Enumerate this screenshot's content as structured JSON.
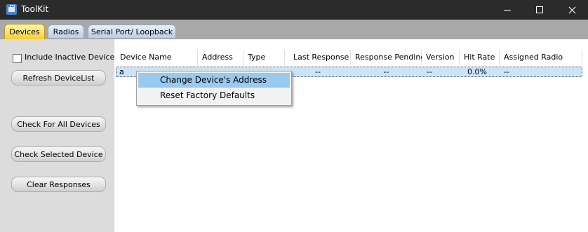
{
  "window": {
    "title": "ToolKit"
  },
  "tabs": [
    {
      "label": "Devices",
      "active": true
    },
    {
      "label": "Radios",
      "active": false
    },
    {
      "label": "Serial Port/ Loopback",
      "active": false
    }
  ],
  "left_panel": {
    "include_inactive": {
      "label": "Include Inactive Devices",
      "checked": false
    },
    "buttons": {
      "refresh": "Refresh DeviceList",
      "check_all": "Check For All Devices",
      "check_selected": "Check Selected Device",
      "clear": "Clear Responses"
    }
  },
  "table": {
    "columns": [
      "Device Name",
      "Address",
      "Type",
      "Last Response",
      "Response Pending",
      "Version",
      "Hit Rate",
      "Assigned Radio"
    ],
    "rows": [
      [
        "a",
        "",
        "",
        "--",
        "--",
        "--",
        "0.0%",
        "--"
      ]
    ]
  },
  "context_menu": {
    "items": [
      "Change Device's Address",
      "Reset Factory Defaults"
    ],
    "highlighted_index": 0
  },
  "colors": {
    "titlebar": "#2b2b2b",
    "tab_active": "#f5cd3a",
    "tab_inactive": "#b9cfe8",
    "selection": "#cce4f7",
    "menu_highlight": "#99c9ef"
  }
}
